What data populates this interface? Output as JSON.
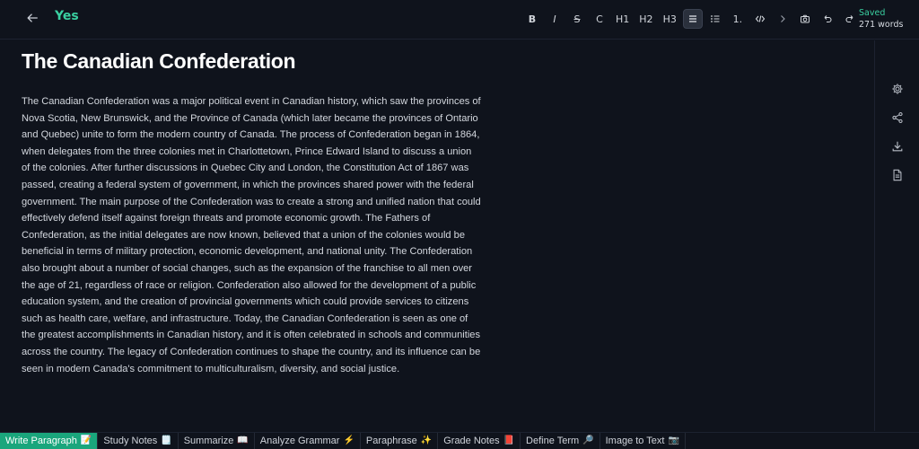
{
  "header": {
    "back_icon": "arrow-left-icon",
    "doc_name": "Yes",
    "toolbar": [
      {
        "name": "bold-button",
        "label": "B",
        "cls": "b"
      },
      {
        "name": "italic-button",
        "label": "I",
        "cls": "i"
      },
      {
        "name": "strike-button",
        "label": "S",
        "cls": "s"
      },
      {
        "name": "code-inline-button",
        "label": "C",
        "cls": ""
      },
      {
        "name": "h1-button",
        "label": "H1",
        "cls": ""
      },
      {
        "name": "h2-button",
        "label": "H2",
        "cls": ""
      },
      {
        "name": "h3-button",
        "label": "H3",
        "cls": ""
      }
    ],
    "ordered_list_label": "1.",
    "status": {
      "saved": "Saved",
      "words": "271 words"
    }
  },
  "document": {
    "title": "The Canadian Confederation",
    "body": "The Canadian Confederation was a major political event in Canadian history, which saw the provinces of Nova Scotia, New Brunswick, and the Province of Canada (which later became the provinces of Ontario and Quebec) unite to form the modern country of Canada. The process of Confederation began in 1864, when delegates from the three colonies met in Charlottetown, Prince Edward Island to discuss a union of the colonies. After further discussions in Quebec City and London, the Constitution Act of 1867 was passed, creating a federal system of government, in which the provinces shared power with the federal government. The main purpose of the Confederation was to create a strong and unified nation that could effectively defend itself against foreign threats and promote economic growth. The Fathers of Confederation, as the initial delegates are now known, believed that a union of the colonies would be beneficial in terms of military protection, economic development, and national unity. The Confederation also brought about a number of social changes, such as the expansion of the franchise to all men over the age of 21, regardless of race or religion. Confederation also allowed for the development of a public education system, and the creation of provincial governments which could provide services to citizens such as health care, welfare, and infrastructure. Today, the Canadian Confederation is seen as one of the greatest accomplishments in Canadian history, and it is often celebrated in schools and communities across the country. The legacy of Confederation continues to shape the country, and its influence can be seen in modern Canada's commitment to multiculturalism, diversity, and social justice."
  },
  "sidebar_icons": [
    "gear-icon",
    "share-icon",
    "download-icon",
    "document-icon"
  ],
  "bottom_tabs": [
    {
      "label": "Write Paragraph",
      "emoji": "📝",
      "active": true
    },
    {
      "label": "Study Notes",
      "emoji": "🗒️"
    },
    {
      "label": "Summarize",
      "emoji": "📖"
    },
    {
      "label": "Analyze Grammar",
      "emoji": "⚡"
    },
    {
      "label": "Paraphrase",
      "emoji": "✨"
    },
    {
      "label": "Grade Notes",
      "emoji": "📕"
    },
    {
      "label": "Define Term",
      "emoji": "🔎"
    },
    {
      "label": "Image to Text",
      "emoji": "📷"
    }
  ],
  "colors": {
    "accent": "#3ad0a1",
    "active_tab": "#1aa67c",
    "background": "#0f131c"
  }
}
